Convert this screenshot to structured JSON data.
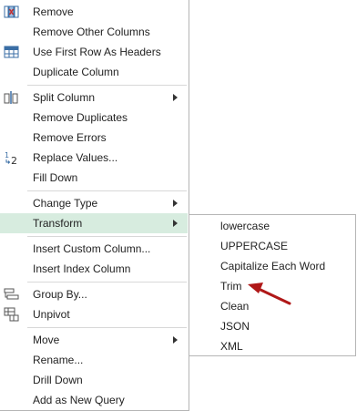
{
  "menu": {
    "items": [
      {
        "label": "Remove"
      },
      {
        "label": "Remove Other Columns"
      },
      {
        "label": "Use First Row As Headers"
      },
      {
        "label": "Duplicate Column"
      },
      {
        "label": "Split Column"
      },
      {
        "label": "Remove Duplicates"
      },
      {
        "label": "Remove Errors"
      },
      {
        "label": "Replace Values..."
      },
      {
        "label": "Fill Down"
      },
      {
        "label": "Change Type"
      },
      {
        "label": "Transform"
      },
      {
        "label": "Insert Custom Column..."
      },
      {
        "label": "Insert Index Column"
      },
      {
        "label": "Group By..."
      },
      {
        "label": "Unpivot"
      },
      {
        "label": "Move"
      },
      {
        "label": "Rename..."
      },
      {
        "label": "Drill Down"
      },
      {
        "label": "Add as New Query"
      }
    ],
    "highlight_color": "#d7ecdf"
  },
  "submenu": {
    "items": [
      {
        "label": "lowercase"
      },
      {
        "label": "UPPERCASE"
      },
      {
        "label": "Capitalize Each Word"
      },
      {
        "label": "Trim"
      },
      {
        "label": "Clean"
      },
      {
        "label": "JSON"
      },
      {
        "label": "XML"
      }
    ]
  },
  "annotation": {
    "arrow_color": "#b01818",
    "points_to": "Trim"
  }
}
